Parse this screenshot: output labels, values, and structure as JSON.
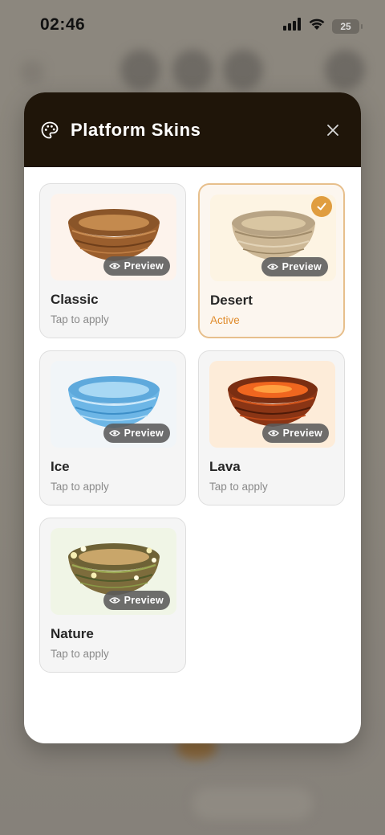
{
  "status_bar": {
    "time": "02:46",
    "battery": "25",
    "icons": [
      "cellular-signal-icon",
      "wifi-icon",
      "battery-icon"
    ]
  },
  "modal": {
    "title": "Platform Skins",
    "header_icon": "palette-icon",
    "close_icon": "close-icon",
    "colors": {
      "header_bg": "#1f1509",
      "accent": "#e09d3f",
      "active_border": "#e7bf8c"
    }
  },
  "skins": [
    {
      "name": "Classic",
      "status": "Tap to apply",
      "preview_label": "Preview",
      "active": false,
      "thumb_bg": "#fdf3ec"
    },
    {
      "name": "Desert",
      "status": "Active",
      "preview_label": "Preview",
      "active": true,
      "thumb_bg": "#fdf4e3"
    },
    {
      "name": "Ice",
      "status": "Tap to apply",
      "preview_label": "Preview",
      "active": false,
      "thumb_bg": "#f1f5f8"
    },
    {
      "name": "Lava",
      "status": "Tap to apply",
      "preview_label": "Preview",
      "active": false,
      "thumb_bg": "#fdecd9"
    },
    {
      "name": "Nature",
      "status": "Tap to apply",
      "preview_label": "Preview",
      "active": false,
      "thumb_bg": "#f0f5e6"
    }
  ]
}
